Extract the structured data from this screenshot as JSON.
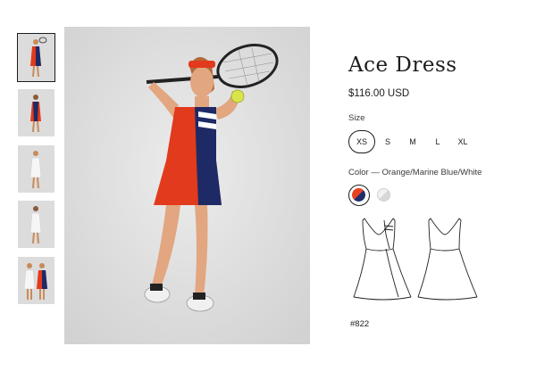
{
  "product": {
    "title": "Ace Dress",
    "price": "$116.00 USD",
    "size_label": "Size",
    "sizes": [
      "XS",
      "S",
      "M",
      "L",
      "XL"
    ],
    "selected_size": "XS",
    "color_label": "Color — Orange/Marine Blue/White",
    "swatches": [
      {
        "name": "Orange/Marine Blue/White",
        "colors": [
          "#e8411e",
          "#1f2d6b"
        ],
        "selected": true
      },
      {
        "name": "White",
        "colors": [
          "#f2f2f2",
          "#d8d8d8"
        ],
        "selected": false
      }
    ],
    "sku": "#822"
  },
  "gallery": {
    "thumbnail_count": 5,
    "active_index": 0
  },
  "colors": {
    "dress_red": "#e23a1c",
    "dress_navy": "#1d2a66",
    "background": "#dcdcdc",
    "text": "#1c1c1c"
  }
}
